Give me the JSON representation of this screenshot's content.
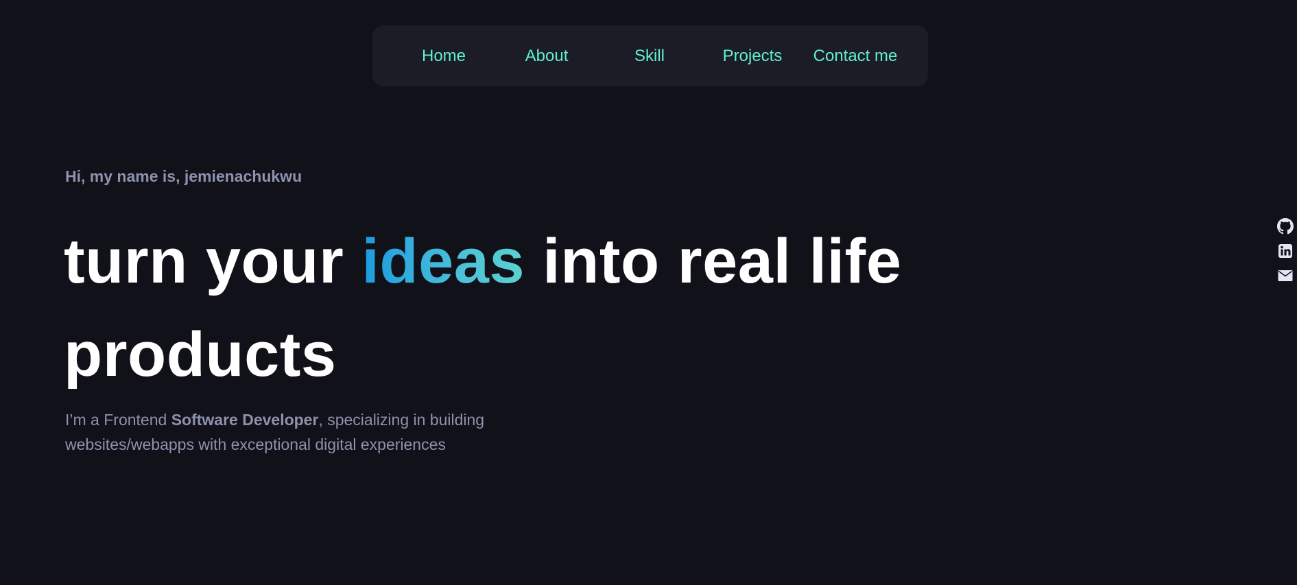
{
  "nav": {
    "items": [
      {
        "label": "Home"
      },
      {
        "label": "About"
      },
      {
        "label": "Skill"
      },
      {
        "label": "Projects"
      },
      {
        "label": "Contact me"
      }
    ]
  },
  "hero": {
    "intro": "Hi, my name is, jemienachukwu",
    "headline_part1": "turn your ",
    "headline_accent": "ideas",
    "headline_part2": " into real life products",
    "tagline_part1": "I’m a Frontend ",
    "tagline_bold": "Software Developer",
    "tagline_part2": ", specializing in building websites/webapps with exceptional digital experiences"
  },
  "socials": [
    {
      "icon": "github-icon"
    },
    {
      "icon": "linkedin-icon"
    },
    {
      "icon": "mail-icon"
    }
  ],
  "colors": {
    "background": "#11111a",
    "nav_background": "#1c1c27",
    "nav_link": "#5ff0d2",
    "muted_text": "#8d92ae",
    "headline": "#ffffff",
    "accent_gradient_start": "#1b9be0",
    "accent_gradient_end": "#5ad2cf",
    "icon": "#e4e6f5"
  }
}
